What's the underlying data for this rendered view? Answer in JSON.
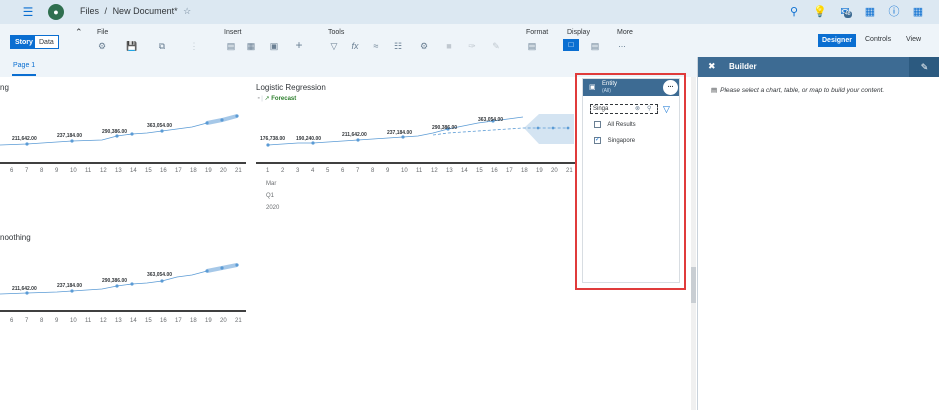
{
  "shell": {
    "breadcrumb_files": "Files",
    "separator": "/",
    "document_title": "New Document*",
    "notification_count": "48",
    "brand_color": "#0a6ed1"
  },
  "toolbar": {
    "view_toggle": {
      "story": "Story",
      "data": "Data"
    },
    "groups": {
      "file": "File",
      "insert": "Insert",
      "tools": "Tools",
      "format": "Format",
      "display": "Display",
      "more": "More"
    },
    "more_icon": "...",
    "mode_tabs": {
      "designer": "Designer",
      "controls": "Controls",
      "view": "View"
    }
  },
  "page_tab": "Page 1",
  "charts": {
    "left_top": {
      "title": "ng",
      "labels": [
        "211,642.00",
        "237,184.00",
        "290,386.00",
        "363,054.00"
      ],
      "x_ticks": [
        "6",
        "7",
        "8",
        "9",
        "10",
        "11",
        "12",
        "13",
        "14",
        "15",
        "16",
        "17",
        "18",
        "19",
        "20",
        "21"
      ]
    },
    "regression": {
      "title": "Logistic Regression",
      "forecast_label": "Forecast",
      "labels": [
        "176,738.00",
        "190,240.00",
        "211,642.00",
        "237,184.00",
        "290,386.00",
        "363,054.00"
      ],
      "x_ticks": [
        "1",
        "2",
        "3",
        "4",
        "5",
        "6",
        "7",
        "8",
        "9",
        "10",
        "11",
        "12",
        "13",
        "14",
        "15",
        "16",
        "17",
        "18",
        "19",
        "20",
        "21"
      ],
      "x_month": "Mar",
      "x_quarter": "Q1",
      "x_year": "2020"
    },
    "left_bottom": {
      "title": "noothing",
      "labels": [
        "211,642.00",
        "237,184.00",
        "290,386.00",
        "363,054.00"
      ],
      "x_ticks": [
        "6",
        "7",
        "8",
        "9",
        "10",
        "11",
        "12",
        "13",
        "14",
        "15",
        "16",
        "17",
        "18",
        "19",
        "20",
        "21"
      ]
    }
  },
  "entity_filter": {
    "title": "Entity",
    "subtitle": "(All)",
    "search_value": "Singa",
    "more_icon": "...",
    "options": [
      {
        "label": "All Results",
        "checked": false
      },
      {
        "label": "Singapore",
        "checked": true
      }
    ]
  },
  "builder": {
    "title": "Builder",
    "hint": "Please select a chart, table, or map to build your content."
  }
}
